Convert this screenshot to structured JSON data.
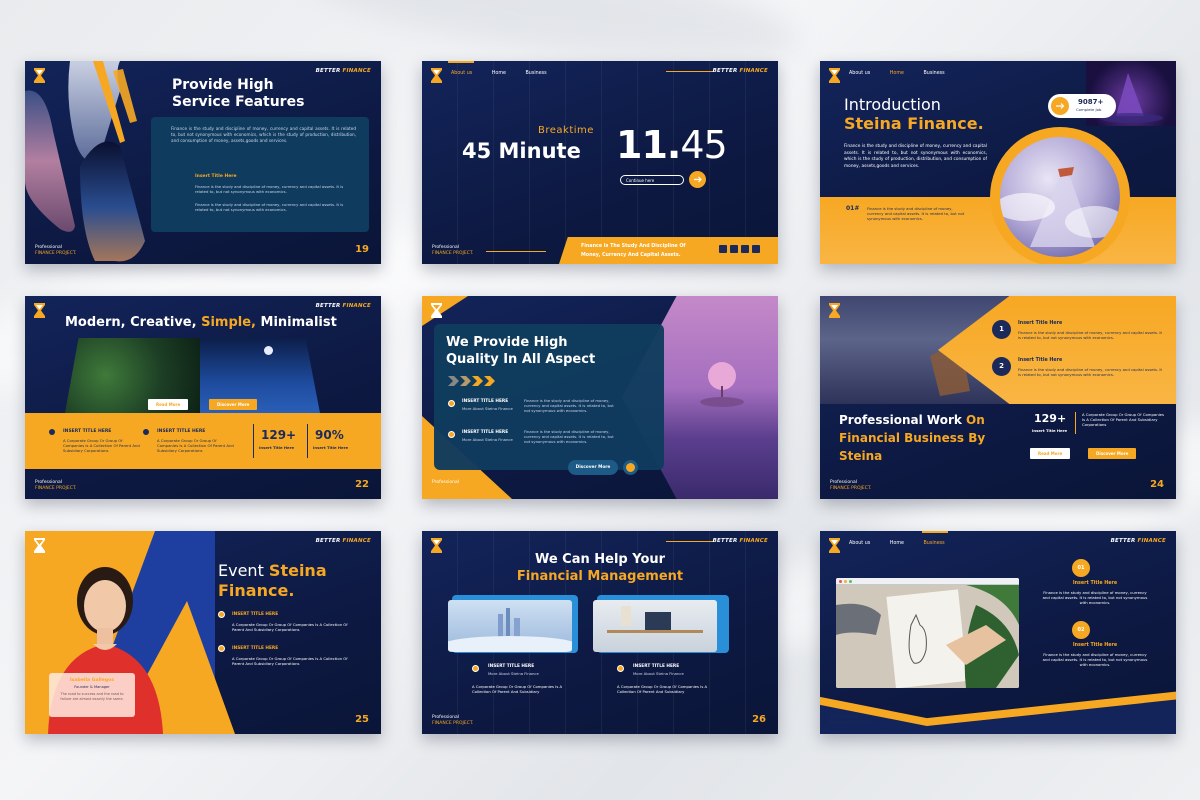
{
  "brand": {
    "prefix": "BETTER",
    "suffix": "FINANCE"
  },
  "footer": {
    "line1": "Professional",
    "line2": "FINANCE PROJECT."
  },
  "s19": {
    "title1": "Provide High",
    "title2": "Service Features",
    "body": "Finance is the study and discipline of money, currency and capital assets. It is related to, but not synonymous with economics, which is the study of production, distribution, and consumption of money, assets,goods and services.",
    "insert": "Insert Title Here",
    "p1": "Finance is the study and discipline of money, currency and capital assets. It is related to, but not synonymous with economics.",
    "p2": "Finance is the study and discipline of money, currency and capital assets. It is related to, but not synonymous with economics.",
    "num": "19"
  },
  "s20": {
    "nav": [
      "About us",
      "Home",
      "Business"
    ],
    "breaktime": "Breaktime",
    "minute": "45 Minute",
    "time_a": "11.",
    "time_b": "45",
    "input": "Continue here",
    "banner": "Finance Is The Study And Discipline Of Money, Currency And Capital Assets."
  },
  "s21": {
    "nav": [
      "About us",
      "Home",
      "Business"
    ],
    "t1": "Introduction",
    "t2": "Steina Finance.",
    "stat": "9087+",
    "stat_label": "Complete Job",
    "body": "Finance is the study and discipline of money, currency and capital assets. It is related to, but not synonymous with economics, which is the study of production, distribution, and consumption of money, assets,goods and services.",
    "idx": "01#",
    "p": "Finance is the study and discipline of money, currency and capital assets. It is related to, but not synonymous with economics."
  },
  "s22": {
    "t_a": "Modern, Creative, ",
    "t_b": "Simple, ",
    "t_c": "Minimalist",
    "read": "Read More",
    "discover": "Discover More",
    "insert1": "INSERT TITLE HERE",
    "insert2": "INSERT TITLE HERE",
    "p1": "A Corporate Group Or Group Of Companies Is A Collection Of Parent And Subsidiary Corporations",
    "p2": "A Corporate Group Or Group Of Companies Is A Collection Of Parent And Subsidiary Corporations",
    "stat1": "129+",
    "stat1_l": "Insert Title Here",
    "stat2": "90%",
    "stat2_l": "Insert Title Here",
    "num": "22"
  },
  "s23": {
    "t1": "We Provide High",
    "t2": "Quality In All Aspect",
    "i1": "INSERT TITLE HERE",
    "i1s": "More About Steina Finance",
    "i2": "INSERT TITLE HERE",
    "i2s": "More About Steina Finance",
    "p1": "Finance is the study and discipline of money, currency and capital assets. It is related to, but not synonymous with economics.",
    "p2": "Finance is the study and discipline of money, currency and capital assets. It is related to, but not synonymous with economics.",
    "btn": "Discover More"
  },
  "s24": {
    "n1": "1",
    "n2": "2",
    "i1": "Insert Title Here",
    "i2": "Insert Title Here",
    "p1": "Finance is the study and discipline of money, currency and capital assets. It is related to, but not synonymous with economics.",
    "p2": "Finance is the study and discipline of money, currency and capital assets. It is related to, but not synonymous with economics.",
    "t_a": "Professional Work ",
    "t_b": "On",
    "t_c": "Financial Business By",
    "t_d": "Steina",
    "stat": "129+",
    "stat_l": "Insert Title Here",
    "statp": "A Corporate Group Or Group Of Companies Is A Collection Of Parent And Subsidiary Corporations",
    "read": "Read More",
    "discover": "Discover More",
    "num": "24"
  },
  "s25": {
    "t1": "Event ",
    "t2": "Steina",
    "t3": "Finance.",
    "i1": "INSERT TITLE HERE",
    "i2": "INSERT TITLE HERE",
    "p1": "A Corporate Group Or Group Of Companies Is A Collection Of Parent And Subsidiary Corporations",
    "p2": "A Corporate Group Or Group Of Companies Is A Collection Of Parent And Subsidiary Corporations",
    "name": "Isabella Gallegos",
    "role": "Founder & Manager",
    "quote": "The road to success and the road to failure are almost exactly the same.",
    "num": "25"
  },
  "s26": {
    "t1": "We Can Help Your",
    "t2": "Financial Management",
    "i1": "INSERT TITLE HERE",
    "i1s": "More About Steina Finance",
    "i2": "INSERT TITLE HERE",
    "i2s": "More About Steina Finance",
    "p1": "A Corporate Group Or Group Of Companies Is A Collection Of Parent And Subsidiary",
    "p2": "A Corporate Group Or Group Of Companies Is A Collection Of Parent And Subsidiary",
    "num": "26"
  },
  "s27": {
    "nav": [
      "About us",
      "Home",
      "Business"
    ],
    "n1": "01",
    "n2": "02",
    "i1": "Insert Title Here",
    "i2": "Insert Title Here",
    "p1": "Finance is the study and discipline of money, currency and capital assets. It is related to, but not synonymous with economics.",
    "p2": "Finance is the study and discipline of money, currency and capital assets. It is related to, but not synonymous with economics."
  }
}
